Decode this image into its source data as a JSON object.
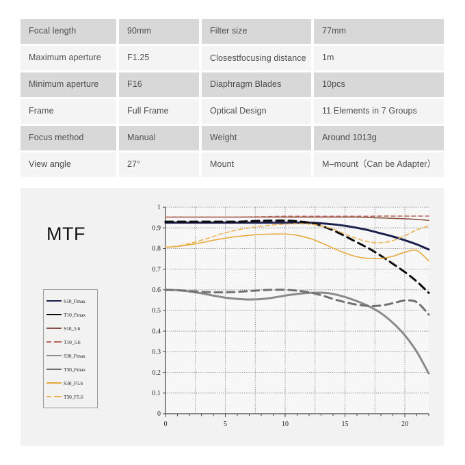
{
  "spec_table": {
    "rows": [
      {
        "label": "Focal length",
        "value": "90mm",
        "label2": "Filter size",
        "value2": "77mm",
        "shade": "dark"
      },
      {
        "label": "Maximum aperture",
        "value": "F1.25",
        "label2": "Closest\nfocusing distance",
        "value2": "1m",
        "shade": "light"
      },
      {
        "label": "Minimum aperture",
        "value": "F16",
        "label2": "Diaphragm Blades",
        "value2": "10pcs",
        "shade": "dark"
      },
      {
        "label": "Frame",
        "value": "Full Frame",
        "label2": "Optical Design",
        "value2": "11 Elements in 7 Groups",
        "shade": "light"
      },
      {
        "label": "Focus method",
        "value": "Manual",
        "label2": "Weight",
        "value2": "Around 1013g",
        "shade": "dark"
      },
      {
        "label": "View angle",
        "value": "27°",
        "label2": "Mount",
        "value2": "M–mount（Can be Adapter）",
        "shade": "light"
      }
    ]
  },
  "mtf": {
    "title": "MTF",
    "legend": [
      {
        "label": "S10_Fmax",
        "color": "#1b1f4b",
        "dash": false
      },
      {
        "label": "T10_Fmax",
        "color": "#0b0b0b",
        "dash": false
      },
      {
        "label": "S10_5.6",
        "color": "#8a5042",
        "dash": false
      },
      {
        "label": "T10_5.6",
        "color": "#b5655a",
        "dash": true
      },
      {
        "label": "S30_Fmax",
        "color": "#8a8a8a",
        "dash": false
      },
      {
        "label": "T30_Fmax",
        "color": "#707070",
        "dash": false
      },
      {
        "label": "S30_F5.6",
        "color": "#e8a93c",
        "dash": false
      },
      {
        "label": "T30_F5.6",
        "color": "#edb254",
        "dash": true
      }
    ]
  },
  "chart_data": {
    "type": "line",
    "title": "MTF",
    "xlabel": "",
    "ylabel": "",
    "xlim": [
      0,
      22
    ],
    "ylim": [
      0,
      1
    ],
    "xticks": [
      0,
      5,
      10,
      15,
      20
    ],
    "xticks_minor_step": 1,
    "yticks": [
      0,
      0.1,
      0.2,
      0.3,
      0.4,
      0.5,
      0.6,
      0.7,
      0.8,
      0.9,
      1
    ],
    "grid": true,
    "legend_position": "left-outside",
    "x": [
      0,
      1,
      2,
      3,
      4,
      5,
      6,
      7,
      8,
      9,
      10,
      11,
      12,
      13,
      14,
      15,
      16,
      17,
      18,
      19,
      20,
      21,
      22
    ],
    "series": [
      {
        "name": "S10_Fmax",
        "color": "#1b1f4b",
        "dash": false,
        "width": 3.0,
        "values": [
          0.925,
          0.925,
          0.925,
          0.925,
          0.925,
          0.925,
          0.925,
          0.925,
          0.925,
          0.925,
          0.925,
          0.925,
          0.925,
          0.922,
          0.917,
          0.91,
          0.9,
          0.888,
          0.873,
          0.858,
          0.84,
          0.82,
          0.795
        ]
      },
      {
        "name": "T10_Fmax",
        "color": "#0b0b0b",
        "dash": true,
        "width": 3.0,
        "values": [
          0.93,
          0.93,
          0.93,
          0.93,
          0.93,
          0.93,
          0.93,
          0.932,
          0.934,
          0.935,
          0.935,
          0.932,
          0.925,
          0.91,
          0.888,
          0.86,
          0.83,
          0.8,
          0.765,
          0.726,
          0.686,
          0.64,
          0.585
        ]
      },
      {
        "name": "S10_5.6",
        "color": "#8a5042",
        "dash": false,
        "width": 1.6,
        "values": [
          0.952,
          0.952,
          0.952,
          0.952,
          0.952,
          0.952,
          0.952,
          0.952,
          0.952,
          0.952,
          0.952,
          0.952,
          0.952,
          0.952,
          0.952,
          0.952,
          0.952,
          0.95,
          0.948,
          0.946,
          0.944,
          0.941,
          0.936
        ]
      },
      {
        "name": "T10_5.6",
        "color": "#b5655a",
        "dash": true,
        "width": 1.6,
        "values": [
          0.952,
          0.952,
          0.952,
          0.952,
          0.952,
          0.952,
          0.952,
          0.953,
          0.954,
          0.955,
          0.956,
          0.956,
          0.956,
          0.956,
          0.956,
          0.956,
          0.956,
          0.956,
          0.957,
          0.957,
          0.957,
          0.957,
          0.957
        ]
      },
      {
        "name": "S30_Fmax",
        "color": "#8a8a8a",
        "dash": false,
        "width": 3.0,
        "values": [
          0.6,
          0.598,
          0.592,
          0.583,
          0.572,
          0.562,
          0.556,
          0.553,
          0.555,
          0.562,
          0.572,
          0.58,
          0.585,
          0.586,
          0.58,
          0.565,
          0.545,
          0.52,
          0.487,
          0.44,
          0.38,
          0.3,
          0.195
        ]
      },
      {
        "name": "T30_Fmax",
        "color": "#707070",
        "dash": true,
        "width": 3.0,
        "values": [
          0.6,
          0.598,
          0.594,
          0.59,
          0.588,
          0.588,
          0.59,
          0.594,
          0.598,
          0.6,
          0.6,
          0.596,
          0.588,
          0.574,
          0.556,
          0.54,
          0.528,
          0.522,
          0.524,
          0.535,
          0.548,
          0.54,
          0.48
        ]
      },
      {
        "name": "S30_F5.6",
        "color": "#e8a93c",
        "dash": false,
        "width": 1.6,
        "values": [
          0.806,
          0.81,
          0.818,
          0.828,
          0.84,
          0.85,
          0.858,
          0.864,
          0.868,
          0.87,
          0.87,
          0.864,
          0.85,
          0.828,
          0.802,
          0.778,
          0.76,
          0.752,
          0.752,
          0.762,
          0.782,
          0.79,
          0.74
        ]
      },
      {
        "name": "T30_F5.6",
        "color": "#edb254",
        "dash": true,
        "width": 1.6,
        "values": [
          0.806,
          0.812,
          0.824,
          0.84,
          0.858,
          0.876,
          0.89,
          0.9,
          0.908,
          0.914,
          0.918,
          0.92,
          0.918,
          0.91,
          0.894,
          0.87,
          0.848,
          0.832,
          0.828,
          0.838,
          0.862,
          0.89,
          0.91
        ]
      }
    ]
  }
}
